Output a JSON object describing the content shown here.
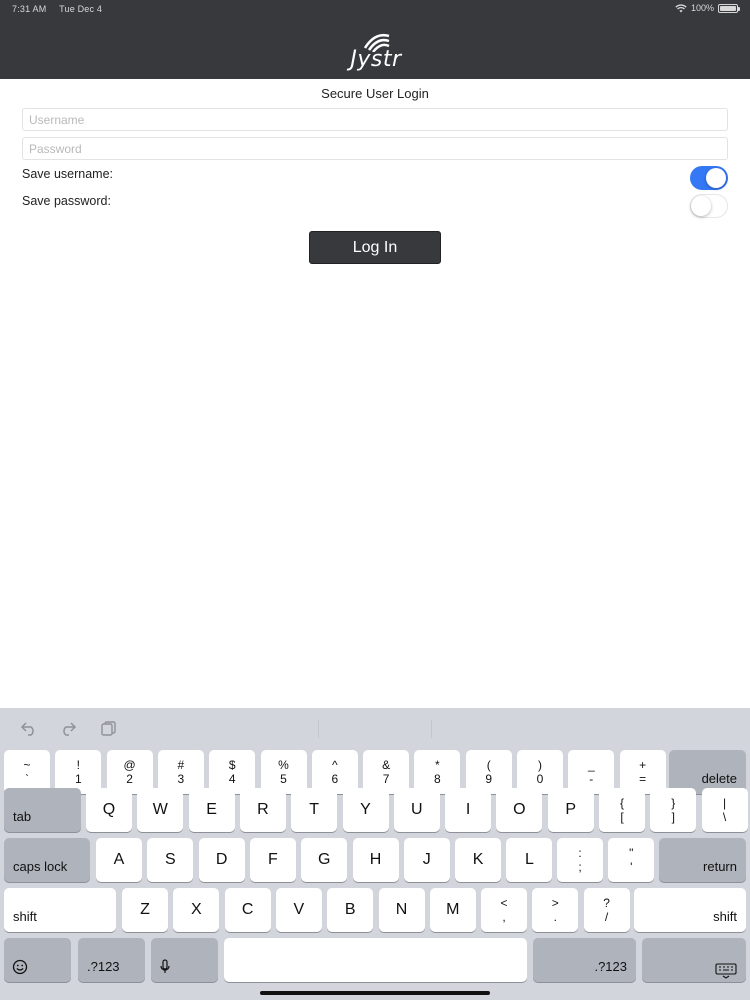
{
  "status_bar": {
    "time": "7:31 AM",
    "date": "Tue Dec 4",
    "battery": "100%"
  },
  "header": {
    "logo_text": "Jystr"
  },
  "login": {
    "title": "Secure User Login",
    "username_placeholder": "Username",
    "password_placeholder": "Password",
    "save_username_label": "Save username:",
    "save_username_on": true,
    "save_password_label": "Save password:",
    "save_password_on": false,
    "login_button": "Log In"
  },
  "colors": {
    "header_bg": "#37393d",
    "toggle_on": "#3478f6",
    "keyboard_bg": "#d2d5db"
  },
  "keyboard": {
    "toolbar_icons": [
      "undo-icon",
      "redo-icon",
      "paste-icon"
    ],
    "number_row": [
      {
        "top": "~",
        "bot": "`"
      },
      {
        "top": "!",
        "bot": "1"
      },
      {
        "top": "@",
        "bot": "2"
      },
      {
        "top": "#",
        "bot": "3"
      },
      {
        "top": "$",
        "bot": "4"
      },
      {
        "top": "%",
        "bot": "5"
      },
      {
        "top": "^",
        "bot": "6"
      },
      {
        "top": "&",
        "bot": "7"
      },
      {
        "top": "*",
        "bot": "8"
      },
      {
        "top": "(",
        "bot": "9"
      },
      {
        "top": ")",
        "bot": "0"
      },
      {
        "top": "_",
        "bot": "-"
      },
      {
        "top": "+",
        "bot": "="
      }
    ],
    "delete": "delete",
    "tab": "tab",
    "row_q": [
      "Q",
      "W",
      "E",
      "R",
      "T",
      "Y",
      "U",
      "I",
      "O",
      "P"
    ],
    "row_q_sym": [
      {
        "top": "{",
        "bot": "["
      },
      {
        "top": "}",
        "bot": "]"
      },
      {
        "top": "|",
        "bot": "\\"
      }
    ],
    "caps_lock": "caps lock",
    "row_a": [
      "A",
      "S",
      "D",
      "F",
      "G",
      "H",
      "J",
      "K",
      "L"
    ],
    "row_a_sym": [
      {
        "top": ":",
        "bot": ";"
      },
      {
        "top": "\"",
        "bot": "'"
      }
    ],
    "return": "return",
    "shift": "shift",
    "row_z": [
      "Z",
      "X",
      "C",
      "V",
      "B",
      "N",
      "M"
    ],
    "row_z_sym": [
      {
        "top": "<",
        "bot": ","
      },
      {
        "top": ">",
        "bot": "."
      },
      {
        "top": "?",
        "bot": "/"
      }
    ],
    "numbers_key": ".?123",
    "emoji_icon": "emoji-icon",
    "mic_icon": "microphone-icon",
    "hide_icon": "keyboard-hide-icon"
  }
}
